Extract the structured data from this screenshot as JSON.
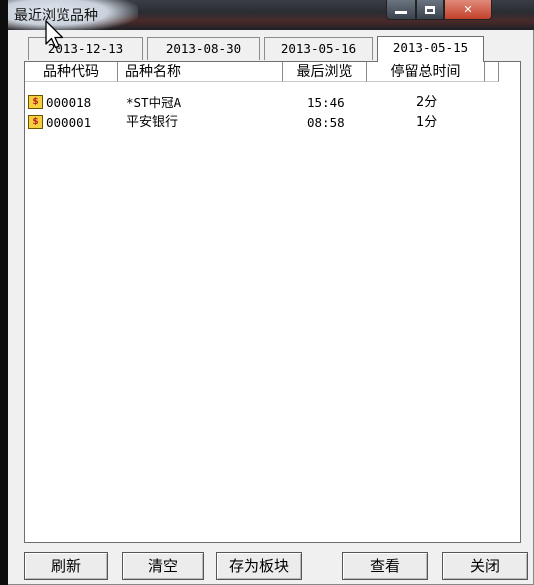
{
  "window": {
    "title": "最近浏览品种"
  },
  "tabs": [
    {
      "label": "2013-12-13",
      "active": false
    },
    {
      "label": "2013-08-30",
      "active": false
    },
    {
      "label": "2013-05-16",
      "active": false
    },
    {
      "label": "2013-05-15",
      "active": true
    }
  ],
  "table": {
    "columns": [
      "品种代码",
      "品种名称",
      "最后浏览",
      "停留总时间"
    ],
    "rows": [
      {
        "code": "000018",
        "name": "*ST中冠A",
        "last_view": "15:46",
        "duration": "2分",
        "icon": "stock-icon"
      },
      {
        "code": "000001",
        "name": "平安银行",
        "last_view": "08:58",
        "duration": "1分",
        "icon": "stock-icon"
      }
    ]
  },
  "buttons": {
    "refresh": "刷新",
    "clear": "清空",
    "save_block": "存为板块",
    "view": "查看",
    "close": "关闭"
  },
  "colors": {
    "window_bg": "#f0f0f0",
    "list_bg": "#ffffff",
    "stock_icon": "#f4d03f",
    "close_button": "#c2402a"
  }
}
